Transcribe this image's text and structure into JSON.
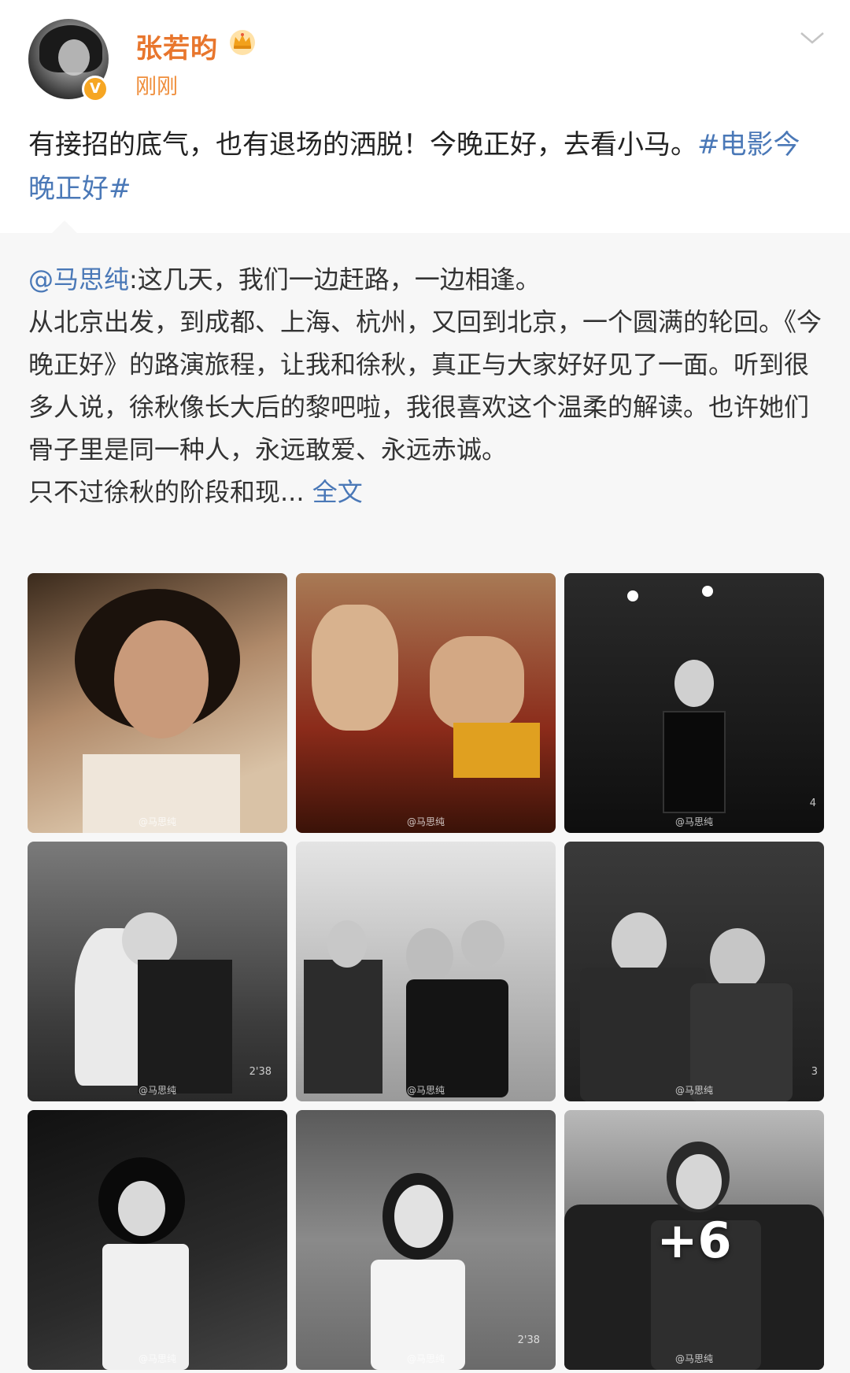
{
  "post": {
    "author": "张若昀",
    "time": "刚刚",
    "text_main": "有接招的底气，也有退场的洒脱！今晚正好，去看小马。",
    "hashtag": "#电影今晚正好#"
  },
  "repost": {
    "mention": "@马思纯",
    "lines": [
      ":这几天，我们一边赶路，一边相逢。",
      "从北京出发，到成都、上海、杭州，又回到北京，一个圆满的轮回。《今晚正好》的路演旅程，让我和徐秋，真正与大家好好见了一面。听到很多人说，徐秋像长大后的黎吧啦，我很喜欢这个温柔的解读。也许她们骨子里是同一种人，永远敢爱、永远赤诚。",
      "只不过徐秋的阶段和现..."
    ],
    "full_text_link": "全文"
  },
  "images": {
    "watermark": "@马思纯",
    "more_count": "+6",
    "photo_codes": [
      "4",
      "2'38",
      "3",
      "2'38"
    ]
  },
  "icons": {
    "verify": "verified-badge-icon",
    "crown": "crown-icon",
    "more": "chevron-down-icon"
  },
  "colors": {
    "username": "#e8762d",
    "timestamp": "#ef8d3a",
    "link": "#4a78b7",
    "badge": "#f6a623"
  }
}
